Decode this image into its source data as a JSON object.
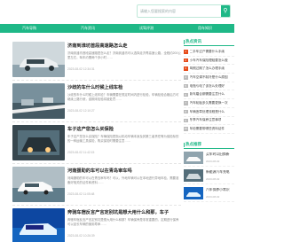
{
  "header": {
    "search_placeholder": "请输入您要搜索的内容"
  },
  "nav": {
    "items": [
      "汽车导购",
      "汽车资讯",
      "试驾评测",
      "用车知识"
    ]
  },
  "articles": [
    {
      "title": "济南到淮坊首段高速路怎么走",
      "desc": "济南到潍坊首段高速路是怎么走？济南到潍坊可以选择走济青高速公路，全程约200公里左右，驾车约需两个多小时……",
      "date": "2023-08-02 12:34:31"
    },
    {
      "title": "沙歧的车什么时候上线车检",
      "desc": "沙歧的车什么时候上线车检？车辆需要在规定时间内进行检验，车辆检验合格后方可继续上路行驶，逾期未检验将被处罚……",
      "date": "2023-08-02 12:10:27"
    },
    {
      "title": "车子这产您怎么买保险",
      "desc": "车子这产您怎么买保险？车辆保险是指以机动车辆本身及其第三者责任等为保险标的的一种运输工具保险，购买保险时需要注意……",
      "date": "2023-08-02 11:42:15"
    },
    {
      "title": "河南援助的车可以在青岛审车吗",
      "desc": "河南援助的车可以在青岛审车吗？可以，外地车辆可以在本地进行异地年检，需要准备好相关的证件和资料……",
      "date": "2023-08-02 11:05:48"
    },
    {
      "title": "奔驰车宿反言产言定别坑是想大用什么和那，车子",
      "desc": "奔驰车宿反言产言定别坑是想大用什么和那？车辆保养是非常重要的，定期进行保养可以延长车辆的使用寿命……",
      "date": "2023-08-02 10:26:39"
    }
  ],
  "sidebar": {
    "hot_title": "热点资讯",
    "hot_items": [
      "二手车过户需要什么手续",
      "小车汽车保险理赔要怎么做",
      "驾照过期了怎么办理手续",
      "汽车空调不制冷是什么原因",
      "电瓶亏电了该怎么处理好",
      "新车磨合期需要注意什么",
      "汽车轮胎多久需要更换一次",
      "车辆违章处理流程是什么",
      "冬季汽车保养注意事项",
      "年检需要带哪些资料证件"
    ],
    "rec_title": "热点推荐",
    "rec_items": [
      {
        "title": "买车时以旧换新",
        "date": "2023-08-02"
      },
      {
        "title": "新能源汽车充电",
        "date": "2023-08-02"
      },
      {
        "title": "汽车保养小常识",
        "date": "2023-08-02"
      }
    ]
  }
}
